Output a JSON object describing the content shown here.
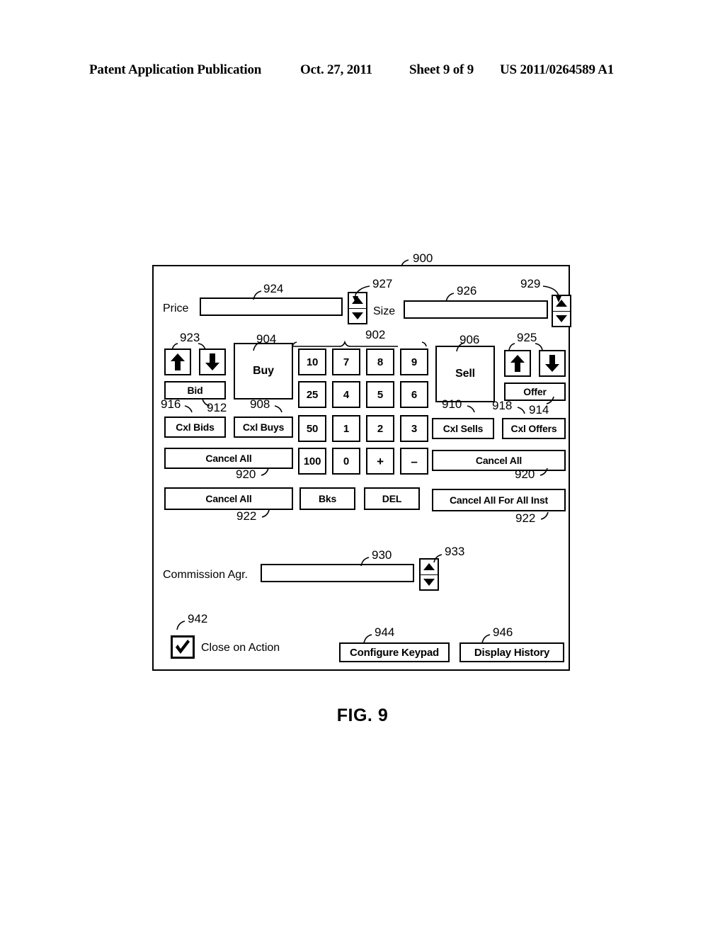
{
  "page_header": {
    "publication": "Patent Application Publication",
    "date": "Oct. 27, 2011",
    "sheet": "Sheet 9 of 9",
    "patent_number": "US 2011/0264589 A1"
  },
  "figure": {
    "caption": "FIG. 9",
    "reference": "900"
  },
  "price_row": {
    "label": "Price",
    "field_value": "",
    "field_ref": "924",
    "spinner_ref": "927",
    "spinner_up": "▲",
    "spinner_down": "▼"
  },
  "size_row": {
    "label": "Size",
    "field_value": "",
    "field_ref": "926",
    "spinner_ref": "929",
    "spinner_up": "▲",
    "spinner_down": "▼"
  },
  "left_controls": {
    "arrows_ref": "923",
    "up_arrow_name": "up-arrow",
    "down_arrow_name": "down-arrow",
    "bid_label": "Bid",
    "bid_ref": "912",
    "buy_label": "Buy",
    "buy_ref": "904",
    "cxl_bids_label": "Cxl Bids",
    "cxl_bids_ref": "916",
    "cxl_buys_label": "Cxl Buys",
    "cxl_buys_ref": "908",
    "cancel_all_label": "Cancel All",
    "cancel_all_ref_top": "920",
    "cancel_all2_label": "Cancel All",
    "cancel_all_ref_bottom": "922"
  },
  "right_controls": {
    "arrows_ref": "925",
    "up_arrow_name": "up-arrow",
    "down_arrow_name": "down-arrow",
    "offer_label": "Offer",
    "offer_ref": "914",
    "sell_label": "Sell",
    "sell_ref": "906",
    "cxl_sells_label": "Cxl Sells",
    "cxl_sells_ref": "910",
    "cxl_offers_label": "Cxl Offers",
    "cxl_offers_ref": "918",
    "cancel_all_label": "Cancel All",
    "cancel_all_ref_top": "920",
    "cancel_all_inst_label": "Cancel All For All Inst",
    "cancel_all_inst_ref": "922"
  },
  "keypad": {
    "reference": "902",
    "keys": [
      [
        "10",
        "7",
        "8",
        "9"
      ],
      [
        "25",
        "4",
        "5",
        "6"
      ],
      [
        "50",
        "1",
        "2",
        "3"
      ],
      [
        "100",
        "0",
        "+",
        "–"
      ]
    ]
  },
  "middle_buttons": {
    "bks_label": "Bks",
    "del_label": "DEL"
  },
  "commission": {
    "label": "Commission Agr.",
    "field_value": "",
    "field_ref": "930",
    "spinner_ref": "933",
    "spinner_up": "▲",
    "spinner_down": "▼"
  },
  "bottom": {
    "checkbox_ref": "942",
    "checkbox_checked": true,
    "checkbox_mark": "✓",
    "close_on_action_label": "Close on Action",
    "configure_keypad_label": "Configure Keypad",
    "configure_keypad_ref": "944",
    "display_history_label": "Display History",
    "display_history_ref": "946"
  }
}
